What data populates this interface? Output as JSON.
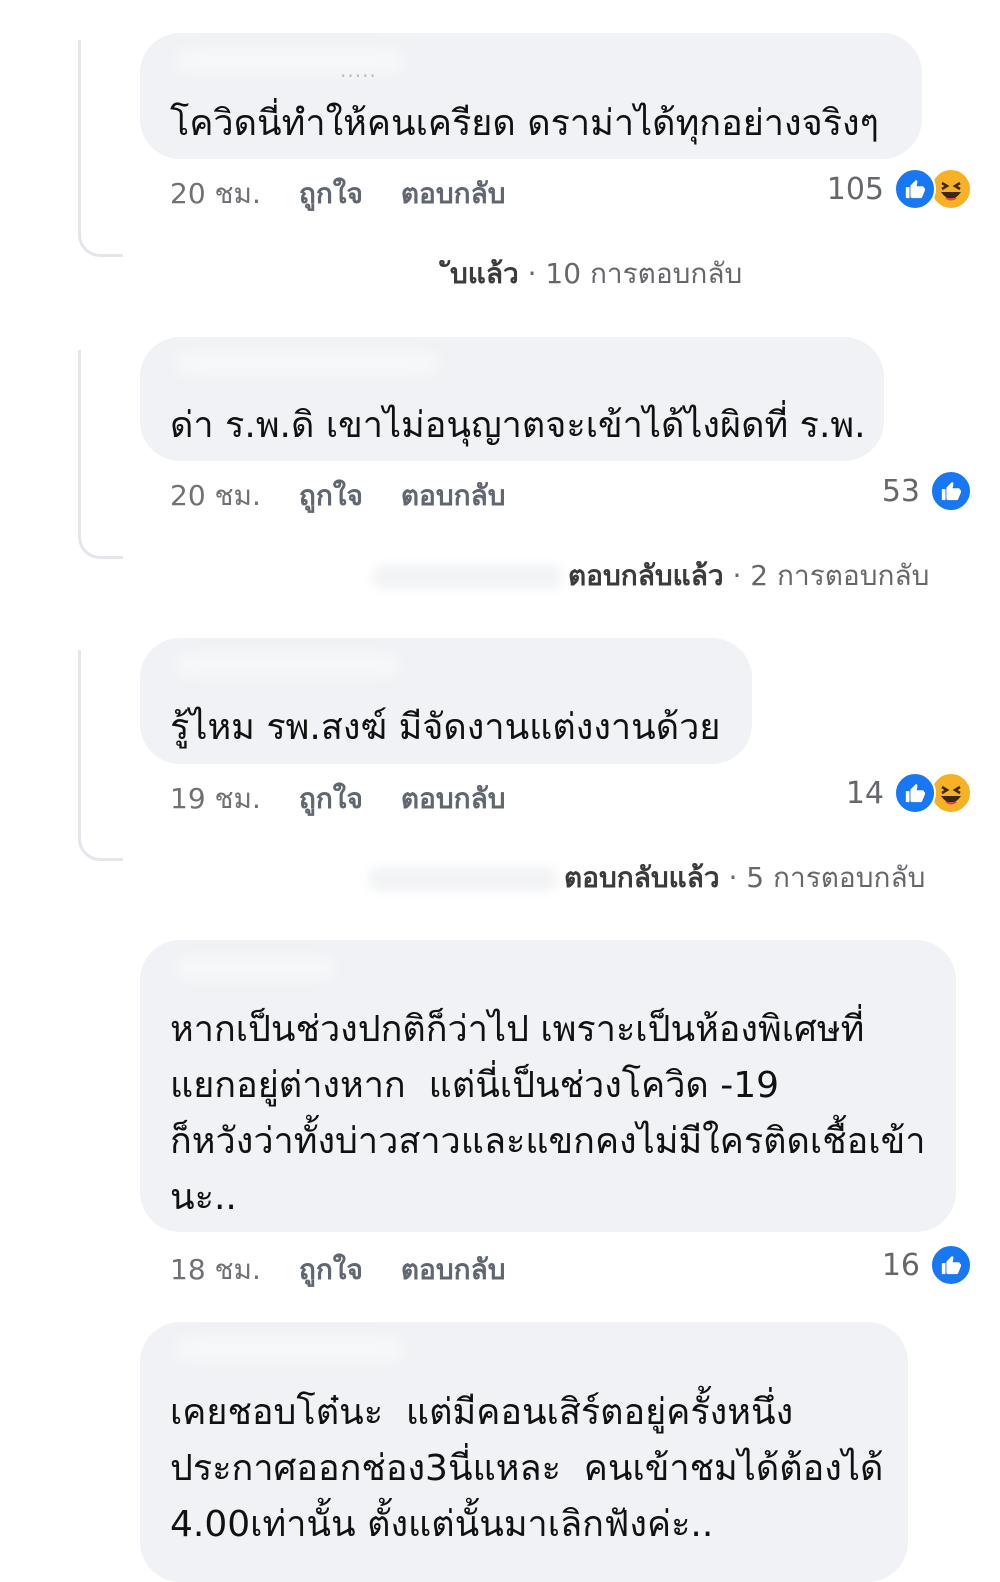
{
  "comments": [
    {
      "author_hint": ".....",
      "text": "โควิดนี่ทำให้คนเครียด ดราม่าได้ทุกอย่างจริงๆ",
      "time": "20 ชม.",
      "like_label": "ถูกใจ",
      "reply_label": "ตอบกลับ",
      "reaction_count": "105",
      "reactions": [
        "like-icon",
        "haha-icon"
      ],
      "replied_text": "ับแล้ว",
      "replies_count_text": "· 10 การตอบกลับ"
    },
    {
      "author_hint": "",
      "text": "ด่า ร.พ.ดิ เขาไม่อนุญาตจะเข้าได้ไงผิดที่ ร.พ.",
      "time": "20 ชม.",
      "like_label": "ถูกใจ",
      "reply_label": "ตอบกลับ",
      "reaction_count": "53",
      "reactions": [
        "like-icon"
      ],
      "replied_text": "ตอบกลับแล้ว",
      "replies_count_text": "· 2 การตอบกลับ"
    },
    {
      "author_hint": "",
      "text": "รู้ไหม รพ.สงฆ์ มีจัดงานแต่งงานด้วย",
      "time": "19 ชม.",
      "like_label": "ถูกใจ",
      "reply_label": "ตอบกลับ",
      "reaction_count": "14",
      "reactions": [
        "like-icon",
        "haha-icon"
      ],
      "replied_text": "ตอบกลับแล้ว",
      "replies_count_text": "· 5 การตอบกลับ"
    },
    {
      "author_hint": "",
      "text": "หากเป็นช่วงปกติก็ว่าไป เพราะเป็นห้องพิเศษที่\nแยกอยู่ต่างหาก  แต่นี่เป็นช่วงโควิด -19\nก็หวังว่าทั้งบ่าวสาวและแขกคงไม่มีใครติดเชื้อเข้า\nนะ..",
      "time": "18 ชม.",
      "like_label": "ถูกใจ",
      "reply_label": "ตอบกลับ",
      "reaction_count": "16",
      "reactions": [
        "like-icon"
      ]
    },
    {
      "author_hint": "",
      "text": "เคยชอบโต๋นะ  แต่มีคอนเสิร์ตอยู่ครั้งหนึ่ง\nประกาศออกช่อง3นี่แหละ  คนเข้าชมได้ต้องได้\n4.00เท่านั้น ตั้งแต่นั้นมาเลิกฟังค่ะ.."
    }
  ],
  "colors": {
    "bubble": "#f0f2f5",
    "meta_text": "#65676b",
    "like_blue": "#1877f2",
    "haha_yellow": "#f7b125"
  }
}
